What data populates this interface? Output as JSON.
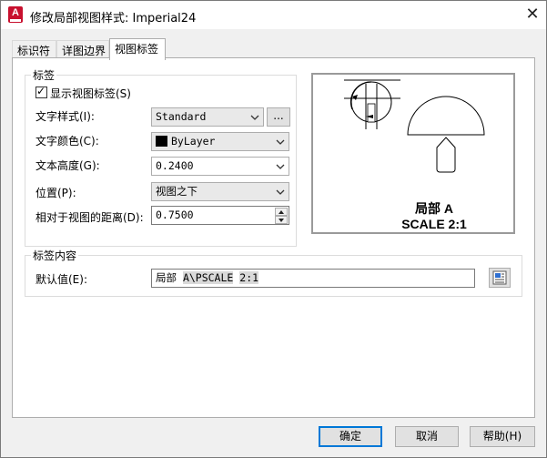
{
  "window": {
    "title": "修改局部视图样式: Imperial24",
    "close_glyph": "✕",
    "app_icon": "autocad-icon",
    "app_icon_letter": "A"
  },
  "tabs": [
    {
      "label": "标识符",
      "active": false
    },
    {
      "label": "详图边界",
      "active": false
    },
    {
      "label": "视图标签",
      "active": true
    }
  ],
  "label_group": {
    "title": "标签",
    "show_label_checkbox": {
      "label": "显示视图标签(S)",
      "checked": true
    },
    "text_style": {
      "label": "文字样式(I):",
      "value": "Standard",
      "browse_label": "..."
    },
    "text_color": {
      "label": "文字颜色(C):",
      "value": "ByLayer",
      "swatch": "#000000"
    },
    "text_height": {
      "label": "文本高度(G):",
      "value": "0.2400"
    },
    "location": {
      "label": "位置(P):",
      "value": "视图之下"
    },
    "distance": {
      "label": "相对于视图的距离(D):",
      "value": "0.7500"
    }
  },
  "preview": {
    "label_line1": "局部 A",
    "label_line2": "SCALE 2:1"
  },
  "content_group": {
    "title": "标签内容",
    "default_value": {
      "label": "默认值(E):",
      "text_plain": "局部",
      "text_code": "A\\PSCALE",
      "text_tail": "2:1"
    },
    "field_button_icon": "insert-field-icon"
  },
  "buttons": {
    "ok": "确定",
    "cancel": "取消",
    "help": "帮助(H)"
  }
}
